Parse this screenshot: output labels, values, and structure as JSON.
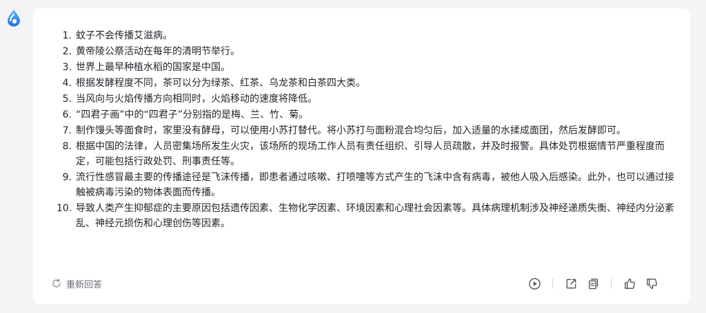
{
  "app": {
    "avatar_icon": "water-drop-logo-icon",
    "accent_color": "#2f8fff"
  },
  "answer": {
    "items": [
      {
        "num": "1.",
        "text": "蚊子不会传播艾滋病。"
      },
      {
        "num": "2.",
        "text": "黄帝陵公祭活动在每年的清明节举行。"
      },
      {
        "num": "3.",
        "text": "世界上最早种植水稻的国家是中国。"
      },
      {
        "num": "4.",
        "text": "根据发酵程度不同，茶可以分为绿茶、红茶、乌龙茶和白茶四大类。"
      },
      {
        "num": "5.",
        "text": "当风向与火焰传播方向相同时，火焰移动的速度将降低。"
      },
      {
        "num": "6.",
        "text": "“四君子画”中的“四君子”分别指的是梅、兰、竹、菊。"
      },
      {
        "num": "7.",
        "text": "制作馒头等面食时，家里没有酵母，可以使用小苏打替代。将小苏打与面粉混合均匀后，加入适量的水揉成面团，然后发酵即可。"
      },
      {
        "num": "8.",
        "text": "根据中国的法律，人员密集场所发生火灾，该场所的现场工作人员有责任组织、引导人员疏散，并及时报警。具体处罚根据情节严重程度而定，可能包括行政处罚、刑事责任等。"
      },
      {
        "num": "9.",
        "text": "流行性感冒最主要的传播途径是飞沫传播，即患者通过咳嗽、打喷嚏等方式产生的飞沫中含有病毒，被他人吸入后感染。此外，也可以通过接触被病毒污染的物体表面而传播。"
      },
      {
        "num": "10.",
        "text": "导致人类产生抑郁症的主要原因包括遗传因素、生物化学因素、环境因素和心理社会因素等。具体病理机制涉及神经递质失衡、神经内分泌紊乱、神经元损伤和心理创伤等因素。"
      }
    ]
  },
  "footer": {
    "regenerate_label": "重新回答",
    "regenerate_icon": "refresh-icon",
    "actions": [
      {
        "name": "play-audio-button",
        "icon": "play-circle-icon"
      },
      {
        "name": "share-button",
        "icon": "share-icon"
      },
      {
        "name": "copy-button",
        "icon": "copy-icon"
      },
      {
        "name": "like-button",
        "icon": "thumbs-up-icon"
      },
      {
        "name": "dislike-button",
        "icon": "thumbs-down-icon"
      }
    ]
  }
}
